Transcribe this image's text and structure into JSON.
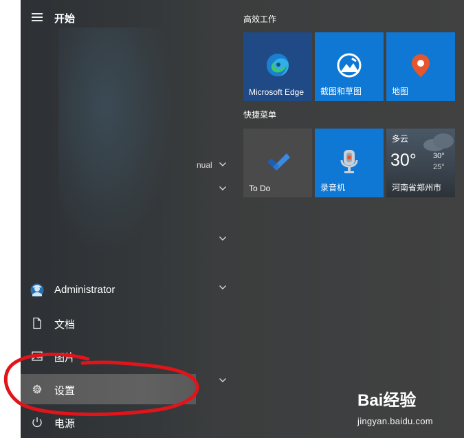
{
  "start_menu": {
    "title": "开始",
    "nav_items": [
      {
        "label": "Administrator",
        "icon": "user-avatar-icon"
      },
      {
        "label": "文档",
        "icon": "document-icon"
      },
      {
        "label": "图片",
        "icon": "picture-icon"
      },
      {
        "label": "设置",
        "icon": "gear-icon",
        "highlighted": true
      },
      {
        "label": "电源",
        "icon": "power-icon"
      }
    ],
    "partial_app_text": "nual"
  },
  "groups": [
    {
      "title": "高效工作",
      "tiles": [
        {
          "label": "Microsoft Edge",
          "icon": "edge-icon",
          "color": "#1f4a85"
        },
        {
          "label": "截图和草图",
          "icon": "snip-sketch-icon",
          "color": "#0f78d4"
        },
        {
          "label": "地图",
          "icon": "map-pin-icon",
          "color": "#0f78d4"
        }
      ]
    },
    {
      "title": "快捷菜单",
      "tiles": [
        {
          "label": "To Do",
          "icon": "todo-check-icon",
          "color": "#4a4a4a"
        },
        {
          "label": "录音机",
          "icon": "microphone-icon",
          "color": "#0f78d4"
        }
      ],
      "weather": {
        "condition": "多云",
        "temperature": "30°",
        "high": "30°",
        "low": "25°",
        "location": "河南省郑州市"
      }
    }
  ],
  "watermark": {
    "logo_text": "Bai经验",
    "url": "jingyan.baidu.com"
  },
  "colors": {
    "tile_blue": "#0f78d4",
    "annotation_red": "#e0141a"
  }
}
